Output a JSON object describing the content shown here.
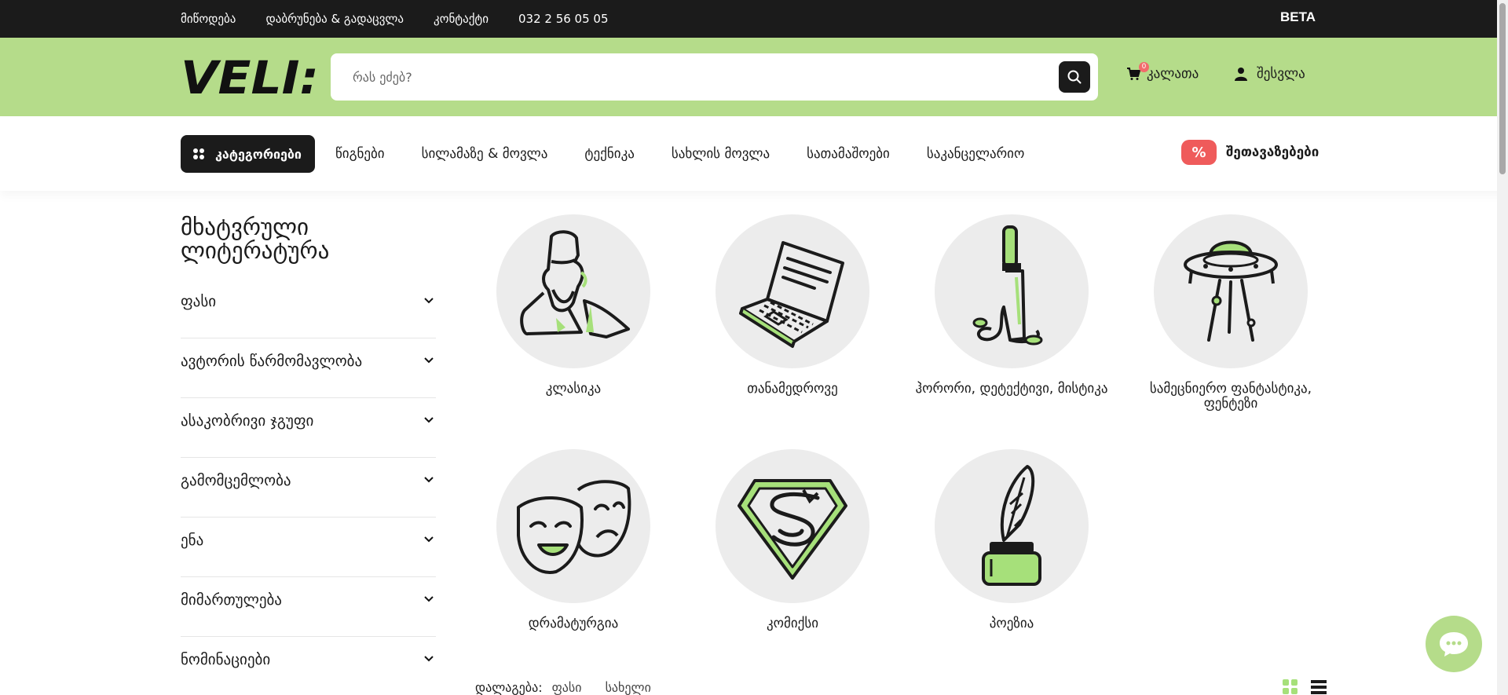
{
  "topbar": {
    "links": [
      "მიწოდება",
      "დაბრუნება & გადაცვლა",
      "კონტაქტი",
      "032 2 56 05 05"
    ],
    "badge": "BETA"
  },
  "header": {
    "logo": "VELI:",
    "search_placeholder": "რას ეძებ?",
    "cart_label": "კალათა",
    "cart_count": "0",
    "login_label": "შესვლა",
    "accent_color": "#b5dc8a"
  },
  "nav": {
    "categories_button": "კატეგორიები",
    "items": [
      "წიგნები",
      "სილამაზე & მოვლა",
      "ტექნიკა",
      "სახლის მოვლა",
      "სათამაშოები",
      "საკანცელარიო"
    ],
    "offers_icon": "%",
    "offers_label": "შეთავაზებები"
  },
  "sidebar": {
    "title_line1": "მხატვრული",
    "title_line2": "ლიტერატურა",
    "filters": [
      "ფასი",
      "ავტორის წარმომავლობა",
      "ასაკობრივი ჯგუფი",
      "გამომცემლობა",
      "ენა",
      "მიმართულება",
      "ნომინაციები"
    ]
  },
  "categories": [
    {
      "label": "კლასიკა",
      "icon": "classic-author-icon"
    },
    {
      "label": "თანამედროვე",
      "icon": "laptop-icon"
    },
    {
      "label": "ჰორორი, დეტექტივი, მისტიკა",
      "icon": "knife-icon"
    },
    {
      "label": "სამეცნიერო ფანტასტიკა, ფენტეზი",
      "icon": "ufo-icon"
    },
    {
      "label": "დრამატურგია",
      "icon": "theater-masks-icon"
    },
    {
      "label": "კომიქსი",
      "icon": "superhero-emblem-icon"
    },
    {
      "label": "პოეზია",
      "icon": "quill-inkwell-icon"
    }
  ],
  "sort": {
    "label": "დალაგება:",
    "options": [
      "ფასი",
      "სახელი"
    ]
  }
}
